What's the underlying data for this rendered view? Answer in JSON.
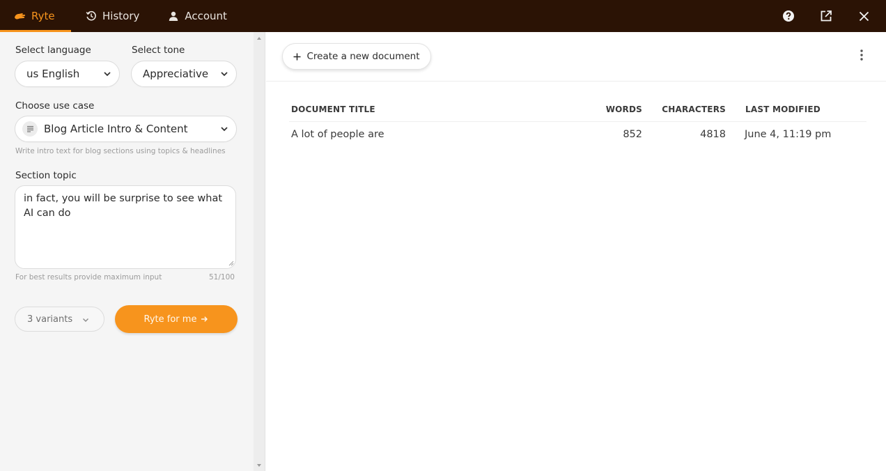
{
  "topbar": {
    "tabs": [
      {
        "label": "Ryte",
        "icon": "ryte-hand-icon",
        "active": true
      },
      {
        "label": "History",
        "icon": "history-icon",
        "active": false
      },
      {
        "label": "Account",
        "icon": "user-icon",
        "active": false
      }
    ],
    "actions": [
      "help-icon",
      "open-external-icon",
      "close-icon"
    ]
  },
  "sidebar": {
    "language_label": "Select language",
    "language_value": "us English",
    "tone_label": "Select tone",
    "tone_value": "Appreciative",
    "usecase_label": "Choose use case",
    "usecase_value": "Blog Article Intro & Content",
    "usecase_hint": "Write intro text for blog sections using topics & headlines",
    "topic_label": "Section topic",
    "topic_value": "in fact, you will be surprise to see what AI can do",
    "topic_hint": "For best results provide maximum input",
    "topic_counter": "51/100",
    "variants_value": "3 variants",
    "ryte_button_label": "Ryte for me",
    "ryte_button_icon": "arrow-right-icon"
  },
  "main": {
    "create_button_label": "Create a new document",
    "create_button_icon": "plus-icon",
    "table": {
      "headers": {
        "title": "DOCUMENT TITLE",
        "words": "WORDS",
        "characters": "CHARACTERS",
        "modified": "LAST MODIFIED"
      },
      "rows": [
        {
          "title": "A lot of people are",
          "words": "852",
          "characters": "4818",
          "modified": "June 4, 11:19 pm"
        }
      ]
    }
  },
  "colors": {
    "topbar": "#2b1305",
    "accent": "#f7941d",
    "sidebar": "#f5f5f5"
  }
}
